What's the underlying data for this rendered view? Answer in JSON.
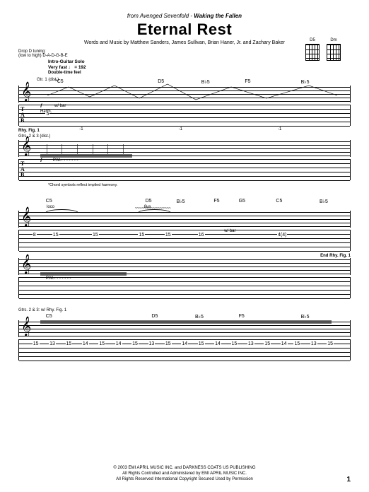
{
  "header": {
    "source_prefix": "from Avenged Sevenfold - ",
    "album": "Waking the Fallen",
    "title": "Eternal Rest",
    "credits": "Words and Music by Matthew Sanders, James Sullivan, Brian Haner, Jr. and Zachary Baker"
  },
  "tuning": {
    "label": "Drop D tuning:",
    "detail": "(low to high) D-A-D-G-B-E"
  },
  "tempo": {
    "section": "Intro-Guitar Solo",
    "marking": "Very fast ♩ = 192",
    "feel": "Double-time feel"
  },
  "chord_diagrams": [
    {
      "name": "D5"
    },
    {
      "name": "Dm"
    }
  ],
  "parts": {
    "gtr1": "Gtr. 1 (dist.)",
    "gtr23": "Gtrs. 2 & 3 (dist.)",
    "gtr23_rhy": "Gtrs. 2 & 3: w/ Rhy. Fig. 1"
  },
  "systems": [
    {
      "chords": [
        {
          "pos": 5,
          "label": "*C5"
        },
        {
          "pos": 38,
          "label": "D5"
        },
        {
          "pos": 52,
          "label": "B♭5"
        },
        {
          "pos": 66,
          "label": "F5"
        },
        {
          "pos": 84,
          "label": "B♭5"
        }
      ],
      "markings": {
        "dynamic": "f",
        "tech1": "w/ bar",
        "tech2": "Harm.",
        "bar_vals": [
          "-1",
          "-1",
          "-1"
        ],
        "harm_pos": "5"
      },
      "rhy_label": "Rhy. Fig. 1",
      "tab_nums_top": [],
      "footnote": "*Chord symbols reflect implied harmony."
    },
    {
      "chords": [
        {
          "pos": 2,
          "label": "C5"
        },
        {
          "pos": 34,
          "label": "D5"
        },
        {
          "pos": 44,
          "label": "B♭5"
        },
        {
          "pos": 56,
          "label": "F5"
        },
        {
          "pos": 64,
          "label": "G5"
        },
        {
          "pos": 76,
          "label": "C5"
        },
        {
          "pos": 90,
          "label": "B♭5"
        }
      ],
      "markings": {
        "loco": "loco",
        "tech": "w/ bar",
        "eight_va": "8va"
      },
      "tab_nums_top": [
        {
          "pos": 4,
          "val": "8"
        },
        {
          "pos": 10,
          "val": "15"
        },
        {
          "pos": 22,
          "val": "15"
        },
        {
          "pos": 36,
          "val": "15"
        },
        {
          "pos": 44,
          "val": "15"
        },
        {
          "pos": 54,
          "val": "16"
        },
        {
          "pos": 78,
          "val": "4(4)"
        }
      ],
      "end_label": "End Rhy. Fig. 1"
    },
    {
      "chords": [
        {
          "pos": 2,
          "label": "C5"
        },
        {
          "pos": 36,
          "label": "D5"
        },
        {
          "pos": 50,
          "label": "B♭5"
        },
        {
          "pos": 64,
          "label": "F5"
        },
        {
          "pos": 84,
          "label": "B♭5"
        }
      ],
      "tab_nums_top": [
        {
          "pos": 4,
          "val": "15"
        },
        {
          "pos": 9,
          "val": "13"
        },
        {
          "pos": 14,
          "val": "15"
        },
        {
          "pos": 19,
          "val": "14"
        },
        {
          "pos": 24,
          "val": "15"
        },
        {
          "pos": 29,
          "val": "14"
        },
        {
          "pos": 34,
          "val": "15"
        },
        {
          "pos": 39,
          "val": "13"
        },
        {
          "pos": 44,
          "val": "15"
        },
        {
          "pos": 49,
          "val": "14"
        },
        {
          "pos": 54,
          "val": "15"
        },
        {
          "pos": 59,
          "val": "14"
        },
        {
          "pos": 64,
          "val": "15"
        },
        {
          "pos": 69,
          "val": "13"
        },
        {
          "pos": 74,
          "val": "15"
        },
        {
          "pos": 79,
          "val": "14"
        },
        {
          "pos": 83,
          "val": "15"
        },
        {
          "pos": 88,
          "val": "13"
        },
        {
          "pos": 93,
          "val": "15"
        }
      ]
    }
  ],
  "footer": {
    "line1": "© 2003 EMI APRIL MUSIC INC. and DARKNESS COATS US PUBLISHING",
    "line2": "All Rights Controlled and Administered by EMI APRIL MUSIC INC.",
    "line3": "All Rights Reserved   International Copyright Secured   Used by Permission"
  },
  "page_number": "1"
}
